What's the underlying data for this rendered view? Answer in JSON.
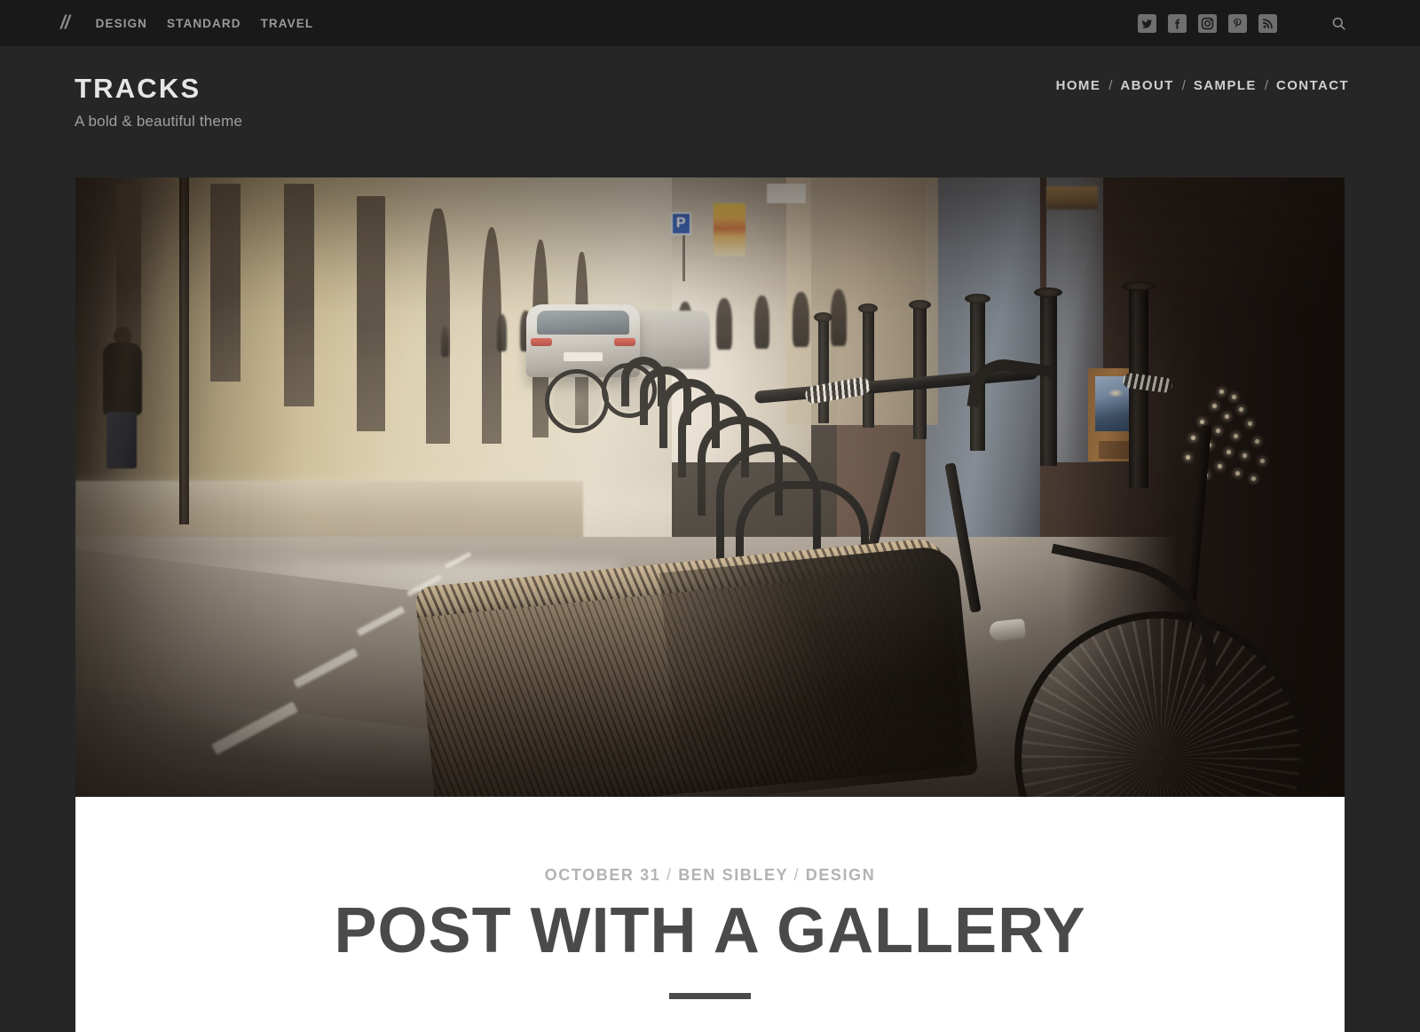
{
  "topbar": {
    "logo": "//",
    "categories": [
      {
        "label": "DESIGN",
        "name": "topbar-link-design"
      },
      {
        "label": "STANDARD",
        "name": "topbar-link-standard"
      },
      {
        "label": "TRAVEL",
        "name": "topbar-link-travel"
      }
    ],
    "social": [
      {
        "name": "twitter-icon",
        "label": "Twitter"
      },
      {
        "name": "facebook-icon",
        "label": "Facebook"
      },
      {
        "name": "instagram-icon",
        "label": "Instagram"
      },
      {
        "name": "pinterest-icon",
        "label": "Pinterest"
      },
      {
        "name": "rss-icon",
        "label": "RSS"
      }
    ],
    "search_label": "Search",
    "background": "#191919"
  },
  "header": {
    "site_title": "TRACKS",
    "site_description": "A bold & beautiful theme",
    "background": "#262626",
    "nav": [
      {
        "label": "HOME"
      },
      {
        "label": "ABOUT"
      },
      {
        "label": "SAMPLE"
      },
      {
        "label": "CONTACT"
      }
    ],
    "nav_separator": "/"
  },
  "featured_image": {
    "alt": "Foggy European street with a row of bicycle racks and a wicker-basket bicycle in the foreground",
    "parking_sign_letter": "P"
  },
  "post": {
    "date": "OCTOBER 31",
    "author": "BEN SIBLEY",
    "category": "DESIGN",
    "meta_separator": "/",
    "title": "POST WITH A GALLERY",
    "title_color": "#4a4a4a",
    "meta_color": "#b3b3b3"
  }
}
